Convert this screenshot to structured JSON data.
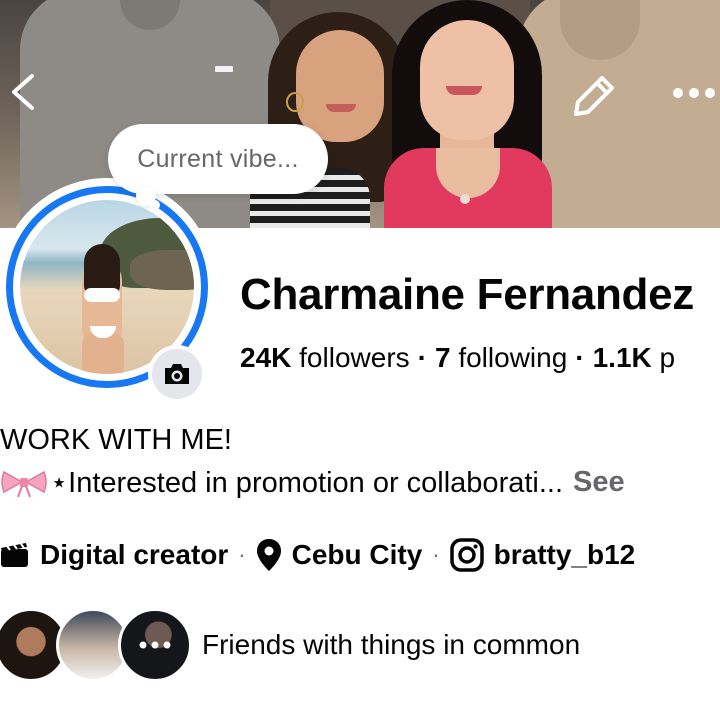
{
  "header": {
    "back_icon": "chevron-left-icon",
    "edit_icon": "pencil-icon",
    "more_icon": "more-horizontal-icon"
  },
  "note": {
    "text": "Current vibe..."
  },
  "profile": {
    "name": "Charmaine Fernandez",
    "camera_icon": "camera-icon",
    "ring_color": "#1877f2"
  },
  "stats": {
    "followers_count": "24K",
    "followers_label": "followers",
    "following_count": "7",
    "following_label": "following",
    "posts_count": "1.1K",
    "posts_label": "p"
  },
  "bio": {
    "line1": "WORK WITH ME!",
    "line2": "⋆Interested in promotion or collaborati...",
    "see_more": "See"
  },
  "details": {
    "category": "Digital creator",
    "location": "Cebu City",
    "instagram": "bratty_b12"
  },
  "friends": {
    "text": "Friends with things in common"
  }
}
